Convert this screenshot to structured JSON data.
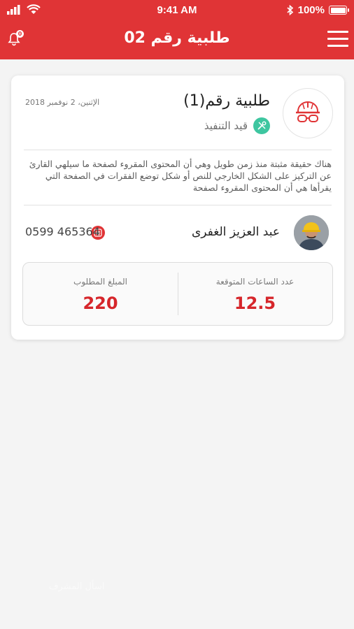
{
  "status_bar": {
    "time": "9:41 AM",
    "battery": "100%",
    "icons": [
      "signal-icon",
      "wifi-icon",
      "bluetooth-icon",
      "battery-icon"
    ]
  },
  "header": {
    "title": "طلبية رقم 02",
    "notification_count": "0",
    "icons": [
      "menu-icon",
      "bell-icon"
    ]
  },
  "order": {
    "title": "طلبية رقم(1)",
    "status": "قيد التنفيذ",
    "date": "الإثنين، 2 نوفمبر 2018",
    "description": "هناك حقيقة مثبتة منذ زمن طويل وهي أن المحتوى المقروء لصفحة ما سيلهي القارئ عن التركيز على الشكل الخارجي للنص أو شكل توضع الفقرات في الصفحة التي يقرأها هي أن المحتوى المقروء لصفحة",
    "icon": "helmet-goggles-icon"
  },
  "worker": {
    "name": "عبد العزيز الغفرى",
    "phone": "0599 465364",
    "icons": [
      "avatar",
      "phone-icon"
    ]
  },
  "stats": {
    "hours_label": "عدد الساعات المتوقعة",
    "hours_value": "12.5",
    "amount_label": "المبلغ المطلوب",
    "amount_value": "220"
  },
  "footer": {
    "faded_label": "اسأل المشرف"
  },
  "colors": {
    "accent": "#e03436",
    "status_green": "#3ec6a0",
    "value_red": "#d6262b"
  }
}
